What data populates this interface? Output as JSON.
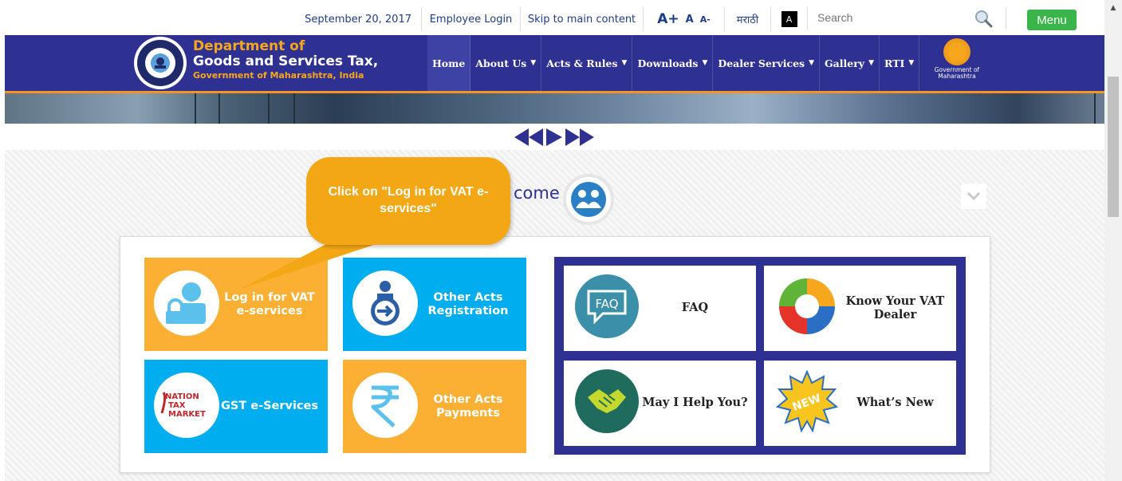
{
  "topbar": {
    "date": "September 20, 2017",
    "employee_login": "Employee Login",
    "skip_link": "Skip to main content",
    "font_increase": "A+",
    "font_normal": "A",
    "font_decrease": "A-",
    "language": "मराठी",
    "contrast": "A",
    "search_placeholder": "Search",
    "menu": "Menu"
  },
  "header": {
    "title_line1": "Department of",
    "title_line2": "Goods and Services Tax,",
    "title_line3": "Government of Maharashtra, India",
    "gov_logo_text": "Government of Maharashtra",
    "nav": [
      {
        "label": "Home",
        "dropdown": false
      },
      {
        "label": "About Us",
        "dropdown": true
      },
      {
        "label": "Acts & Rules",
        "dropdown": true
      },
      {
        "label": "Downloads",
        "dropdown": true
      },
      {
        "label": "Dealer Services",
        "dropdown": true
      },
      {
        "label": "Gallery",
        "dropdown": true
      },
      {
        "label": "RTI",
        "dropdown": true
      }
    ]
  },
  "welcome": {
    "text": "come"
  },
  "callout": {
    "text": "Click on \"Log in for VAT e-services\""
  },
  "tiles": [
    {
      "label": "Log in for VAT e-services",
      "icon": "user-lock-icon"
    },
    {
      "label": "Other Acts Registration",
      "icon": "registration-icon"
    },
    {
      "label": "GST e-Services",
      "icon": "nation-tax-market-icon"
    },
    {
      "label": "Other Acts Payments",
      "icon": "rupee-icon"
    }
  ],
  "quick_links": [
    {
      "label": "FAQ",
      "icon": "faq-icon"
    },
    {
      "label": "Know Your VAT Dealer",
      "icon": "dealer-hands-icon"
    },
    {
      "label": "May I Help You?",
      "icon": "help-handshake-icon"
    },
    {
      "label": "What’s New",
      "icon": "new-badge-icon"
    }
  ],
  "gst_logo_text": [
    "NATION",
    "TAX",
    "MARKET"
  ],
  "colors": {
    "navy": "#2e3192",
    "orange": "#fbb034",
    "blue": "#00aeef",
    "menu_green": "#39b54a",
    "callout": "#f3a714"
  }
}
